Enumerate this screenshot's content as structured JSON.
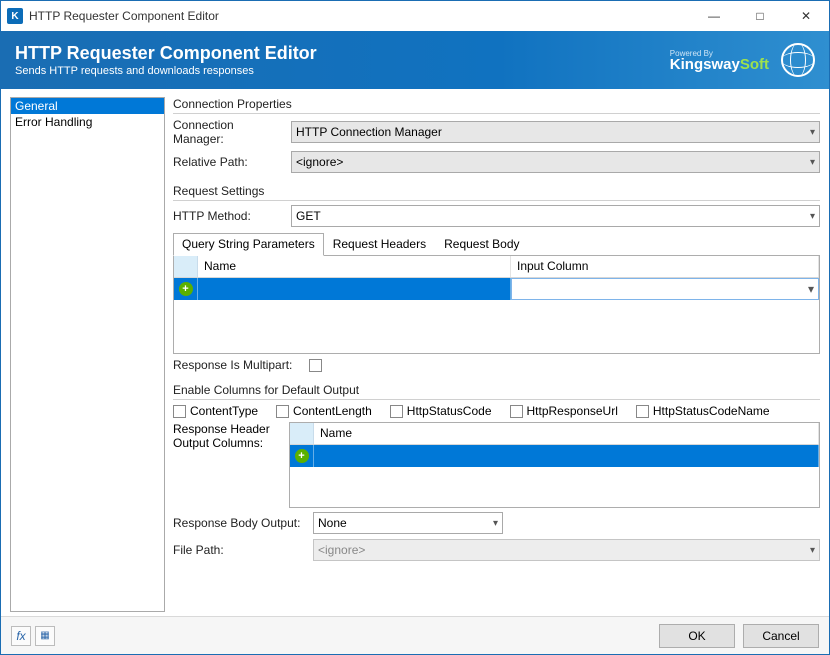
{
  "window": {
    "title": "HTTP Requester Component Editor"
  },
  "banner": {
    "title": "HTTP Requester Component Editor",
    "subtitle": "Sends HTTP requests and downloads responses",
    "powered": "Powered By",
    "brand1": "Kingsway",
    "brand2": "Soft"
  },
  "sidebar": {
    "items": [
      "General",
      "Error Handling"
    ],
    "active": 0
  },
  "conn": {
    "section": "Connection Properties",
    "manager_label": "Connection Manager:",
    "manager_value": "HTTP Connection Manager",
    "path_label": "Relative Path:",
    "path_value": "<ignore>"
  },
  "req": {
    "section": "Request Settings",
    "method_label": "HTTP Method:",
    "method_value": "GET",
    "tabs": [
      "Query String Parameters",
      "Request Headers",
      "Request Body"
    ],
    "active_tab": 0,
    "grid_headers": [
      "Name",
      "Input Column"
    ],
    "multipart_label": "Response Is Multipart:"
  },
  "out": {
    "section": "Enable Columns for Default Output",
    "checks": [
      "ContentType",
      "ContentLength",
      "HttpStatusCode",
      "HttpResponseUrl",
      "HttpStatusCodeName"
    ],
    "resp_header_label": "Response Header Output Columns:",
    "resp_grid_header": "Name",
    "body_label": "Response Body Output:",
    "body_value": "None",
    "file_label": "File Path:",
    "file_value": "<ignore>"
  },
  "footer": {
    "ok": "OK",
    "cancel": "Cancel"
  }
}
